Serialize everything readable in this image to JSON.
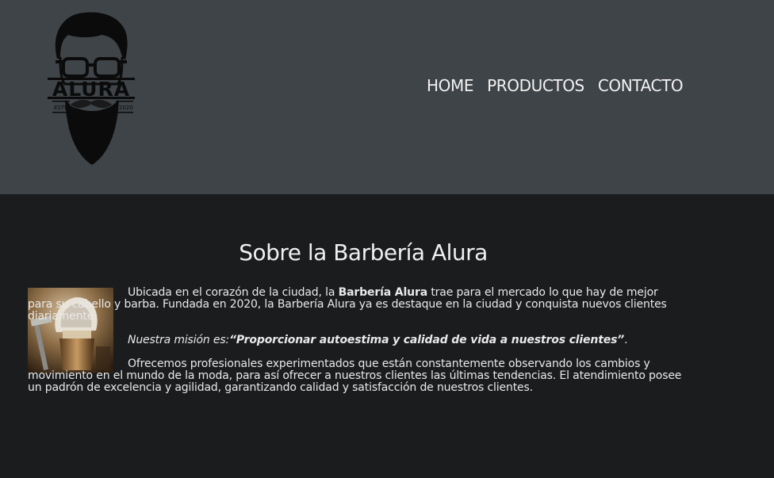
{
  "header": {
    "logo": {
      "brand": "ALURA",
      "left_text": "ESTD",
      "right_text": "2020",
      "icon": "bearded-man-logo"
    },
    "nav": [
      {
        "label": "HOME"
      },
      {
        "label": "PRODUCTOS"
      },
      {
        "label": "CONTACTO"
      }
    ]
  },
  "about": {
    "title": "Sobre la Barbería Alura",
    "image_icon": "shaving-brush-and-razor-photo",
    "p1_before": "Ubicada en el corazón de la ciudad, la ",
    "p1_bold": "Barbería Alura",
    "p1_after": " trae para el mercado lo que hay de mejor para su cabello y barba. Fundada en 2020, la Barbería Alura ya es destaque en la ciudad y conquista nuevos clientes diariamente.",
    "mission_label": "Nuestra misión es:",
    "mission_quote": "“Proporcionar autoestima y calidad de vida a nuestros clientes”",
    "mission_end": ".",
    "p3": "Ofrecemos profesionales experimentados que están constantemente observando los cambios y movimiento en el mundo de la moda, para así ofrecer a nuestros clientes las últimas tendencias. El atendimiento posee un padrón de excelencia y agilidad, garantizando calidad y satisfacción de nuestros clientes."
  },
  "colors": {
    "header_bg": "#3f4448",
    "body_bg": "#1b1c1e",
    "text": "#e9e9e9"
  }
}
